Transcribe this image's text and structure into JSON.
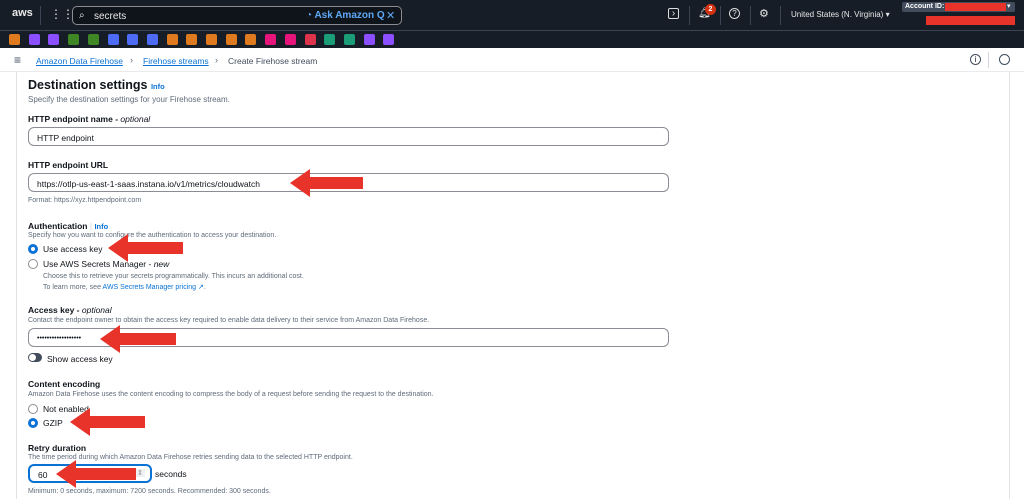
{
  "topnav": {
    "logo": "aws",
    "search_value": "secrets",
    "ask_q": "Ask Amazon Q",
    "notification_count": "2",
    "region": "United States (N. Virginia)",
    "account_label": "Account ID:"
  },
  "favorites_colors": [
    "#e07a1f",
    "#8c4fff",
    "#8c4fff",
    "#3f8624",
    "#3f8624",
    "#4d6bf5",
    "#4d6bf5",
    "#4d6bf5",
    "#e07a1f",
    "#e07a1f",
    "#e07a1f",
    "#e07a1f",
    "#e07a1f",
    "#e7157b",
    "#e7157b",
    "#dd344c",
    "#1b9e77",
    "#1b9e77",
    "#8c4fff",
    "#8c4fff"
  ],
  "breadcrumb": {
    "items": [
      "Amazon Data Firehose",
      "Firehose streams"
    ],
    "current": "Create Firehose stream"
  },
  "form": {
    "title": "Destination settings",
    "info": "Info",
    "description": "Specify the destination settings for your Firehose stream.",
    "endpoint_name": {
      "label": "HTTP endpoint name - ",
      "optional": "optional",
      "value": "HTTP endpoint"
    },
    "endpoint_url": {
      "label": "HTTP endpoint URL",
      "value": "https://otlp-us-east-1-saas.instana.io/v1/metrics/cloudwatch",
      "hint": "Format: https://xyz.httpendpoint.com"
    },
    "auth": {
      "label": "Authentication",
      "info": "Info",
      "description": "Specify how you want to configure the authentication to access your destination.",
      "opt1": "Use access key",
      "opt2": "Use AWS Secrets Manager - ",
      "opt2_new": "new",
      "opt2_desc": "Choose this to retrieve your secrets programmatically. This incurs an additional cost.",
      "opt2_learn": "To learn more, see ",
      "opt2_link": "AWS Secrets Manager pricing",
      "selected": "Use access key"
    },
    "access_key": {
      "label": "Access key - ",
      "optional": "optional",
      "description": "Contact the endpoint owner to obtain the access key required to enable data delivery to their service from Amazon Data Firehose.",
      "value": "••••••••••••••••••",
      "toggle_label": "Show access key",
      "toggle_on": false
    },
    "encoding": {
      "label": "Content encoding",
      "description": "Amazon Data Firehose uses the content encoding to compress the body of a request before sending the request to the destination.",
      "opt1": "Not enabled",
      "opt2": "GZIP",
      "selected": "GZIP"
    },
    "retry": {
      "label": "Retry duration",
      "description": "The time period during which Amazon Data Firehose retries sending data to the selected HTTP endpoint.",
      "value": "60",
      "unit": "seconds",
      "hint": "Minimum: 0 seconds, maximum: 7200 seconds. Recommended: 300 seconds."
    }
  },
  "annotation_color": "#e8332a"
}
